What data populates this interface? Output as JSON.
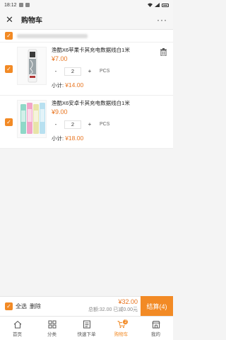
{
  "status": {
    "time": "18:12"
  },
  "header": {
    "title": "购物车",
    "more": "···"
  },
  "items": [
    {
      "title": "渔酷X6苹果卡其充电数据线白1米",
      "price": "¥7.00",
      "qty": "2",
      "unit": "PCS",
      "subtotal_label": "小计:",
      "subtotal": "¥14.00",
      "colors": [
        "#8fa0a8",
        "#c9c9c9",
        "#b03a3a"
      ]
    },
    {
      "title": "渔酷X6安卓卡其充电数据线白1米",
      "price": "¥9.00",
      "qty": "2",
      "unit": "PCS",
      "subtotal_label": "小计:",
      "subtotal": "¥18.00",
      "colors": [
        "#8fd8c8",
        "#f2a4c8",
        "#e8e4a8",
        "#b8e0f0"
      ]
    }
  ],
  "footer": {
    "select_all": "全选",
    "delete": "删除",
    "total": "¥32.00",
    "sub": "总额:32.00 已减0.00元",
    "checkout": "结算(4)"
  },
  "tabs": [
    {
      "label": "首页",
      "icon": "home-icon"
    },
    {
      "label": "分类",
      "icon": "grid-icon"
    },
    {
      "label": "快速下单",
      "icon": "list-icon"
    },
    {
      "label": "购物车",
      "icon": "cart-icon",
      "badge": "2",
      "active": true
    },
    {
      "label": "我的",
      "icon": "shop-icon"
    }
  ],
  "accent": "#f28a25",
  "price_color": "#e8741f"
}
